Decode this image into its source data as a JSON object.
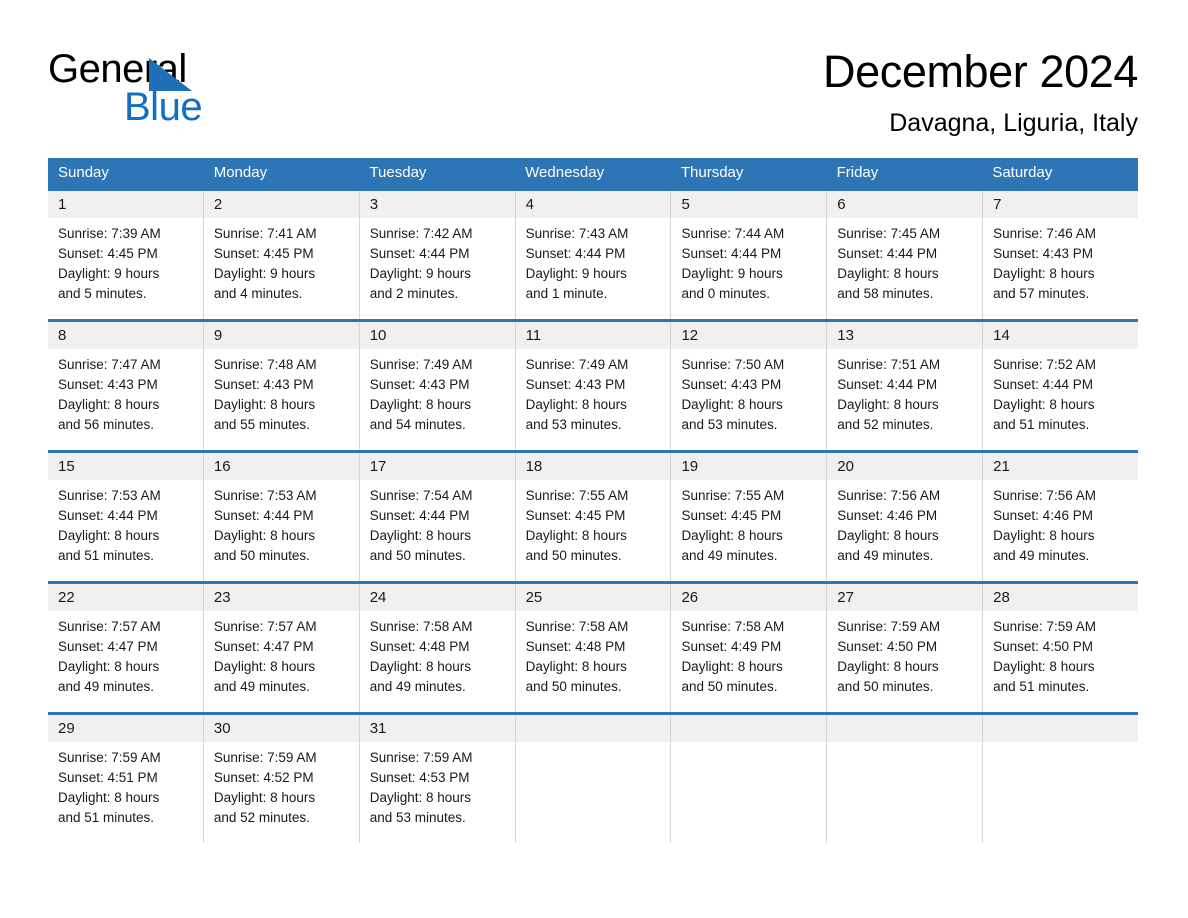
{
  "brand": {
    "name_part1": "General",
    "name_part2": "Blue",
    "triangle_color": "#1e6fb8",
    "blue_color": "#1270c0"
  },
  "header": {
    "month_title": "December 2024",
    "location": "Davagna, Liguria, Italy"
  },
  "theme": {
    "header_blue": "#2e75b6",
    "day_band_gray": "#f0f0f0",
    "divider_gray": "#d5d5d5"
  },
  "weekdays": [
    "Sunday",
    "Monday",
    "Tuesday",
    "Wednesday",
    "Thursday",
    "Friday",
    "Saturday"
  ],
  "weeks": [
    [
      {
        "day": "1",
        "sunrise": "Sunrise: 7:39 AM",
        "sunset": "Sunset: 4:45 PM",
        "daylight_line1": "Daylight: 9 hours",
        "daylight_line2": "and 5 minutes."
      },
      {
        "day": "2",
        "sunrise": "Sunrise: 7:41 AM",
        "sunset": "Sunset: 4:45 PM",
        "daylight_line1": "Daylight: 9 hours",
        "daylight_line2": "and 4 minutes."
      },
      {
        "day": "3",
        "sunrise": "Sunrise: 7:42 AM",
        "sunset": "Sunset: 4:44 PM",
        "daylight_line1": "Daylight: 9 hours",
        "daylight_line2": "and 2 minutes."
      },
      {
        "day": "4",
        "sunrise": "Sunrise: 7:43 AM",
        "sunset": "Sunset: 4:44 PM",
        "daylight_line1": "Daylight: 9 hours",
        "daylight_line2": "and 1 minute."
      },
      {
        "day": "5",
        "sunrise": "Sunrise: 7:44 AM",
        "sunset": "Sunset: 4:44 PM",
        "daylight_line1": "Daylight: 9 hours",
        "daylight_line2": "and 0 minutes."
      },
      {
        "day": "6",
        "sunrise": "Sunrise: 7:45 AM",
        "sunset": "Sunset: 4:44 PM",
        "daylight_line1": "Daylight: 8 hours",
        "daylight_line2": "and 58 minutes."
      },
      {
        "day": "7",
        "sunrise": "Sunrise: 7:46 AM",
        "sunset": "Sunset: 4:43 PM",
        "daylight_line1": "Daylight: 8 hours",
        "daylight_line2": "and 57 minutes."
      }
    ],
    [
      {
        "day": "8",
        "sunrise": "Sunrise: 7:47 AM",
        "sunset": "Sunset: 4:43 PM",
        "daylight_line1": "Daylight: 8 hours",
        "daylight_line2": "and 56 minutes."
      },
      {
        "day": "9",
        "sunrise": "Sunrise: 7:48 AM",
        "sunset": "Sunset: 4:43 PM",
        "daylight_line1": "Daylight: 8 hours",
        "daylight_line2": "and 55 minutes."
      },
      {
        "day": "10",
        "sunrise": "Sunrise: 7:49 AM",
        "sunset": "Sunset: 4:43 PM",
        "daylight_line1": "Daylight: 8 hours",
        "daylight_line2": "and 54 minutes."
      },
      {
        "day": "11",
        "sunrise": "Sunrise: 7:49 AM",
        "sunset": "Sunset: 4:43 PM",
        "daylight_line1": "Daylight: 8 hours",
        "daylight_line2": "and 53 minutes."
      },
      {
        "day": "12",
        "sunrise": "Sunrise: 7:50 AM",
        "sunset": "Sunset: 4:43 PM",
        "daylight_line1": "Daylight: 8 hours",
        "daylight_line2": "and 53 minutes."
      },
      {
        "day": "13",
        "sunrise": "Sunrise: 7:51 AM",
        "sunset": "Sunset: 4:44 PM",
        "daylight_line1": "Daylight: 8 hours",
        "daylight_line2": "and 52 minutes."
      },
      {
        "day": "14",
        "sunrise": "Sunrise: 7:52 AM",
        "sunset": "Sunset: 4:44 PM",
        "daylight_line1": "Daylight: 8 hours",
        "daylight_line2": "and 51 minutes."
      }
    ],
    [
      {
        "day": "15",
        "sunrise": "Sunrise: 7:53 AM",
        "sunset": "Sunset: 4:44 PM",
        "daylight_line1": "Daylight: 8 hours",
        "daylight_line2": "and 51 minutes."
      },
      {
        "day": "16",
        "sunrise": "Sunrise: 7:53 AM",
        "sunset": "Sunset: 4:44 PM",
        "daylight_line1": "Daylight: 8 hours",
        "daylight_line2": "and 50 minutes."
      },
      {
        "day": "17",
        "sunrise": "Sunrise: 7:54 AM",
        "sunset": "Sunset: 4:44 PM",
        "daylight_line1": "Daylight: 8 hours",
        "daylight_line2": "and 50 minutes."
      },
      {
        "day": "18",
        "sunrise": "Sunrise: 7:55 AM",
        "sunset": "Sunset: 4:45 PM",
        "daylight_line1": "Daylight: 8 hours",
        "daylight_line2": "and 50 minutes."
      },
      {
        "day": "19",
        "sunrise": "Sunrise: 7:55 AM",
        "sunset": "Sunset: 4:45 PM",
        "daylight_line1": "Daylight: 8 hours",
        "daylight_line2": "and 49 minutes."
      },
      {
        "day": "20",
        "sunrise": "Sunrise: 7:56 AM",
        "sunset": "Sunset: 4:46 PM",
        "daylight_line1": "Daylight: 8 hours",
        "daylight_line2": "and 49 minutes."
      },
      {
        "day": "21",
        "sunrise": "Sunrise: 7:56 AM",
        "sunset": "Sunset: 4:46 PM",
        "daylight_line1": "Daylight: 8 hours",
        "daylight_line2": "and 49 minutes."
      }
    ],
    [
      {
        "day": "22",
        "sunrise": "Sunrise: 7:57 AM",
        "sunset": "Sunset: 4:47 PM",
        "daylight_line1": "Daylight: 8 hours",
        "daylight_line2": "and 49 minutes."
      },
      {
        "day": "23",
        "sunrise": "Sunrise: 7:57 AM",
        "sunset": "Sunset: 4:47 PM",
        "daylight_line1": "Daylight: 8 hours",
        "daylight_line2": "and 49 minutes."
      },
      {
        "day": "24",
        "sunrise": "Sunrise: 7:58 AM",
        "sunset": "Sunset: 4:48 PM",
        "daylight_line1": "Daylight: 8 hours",
        "daylight_line2": "and 49 minutes."
      },
      {
        "day": "25",
        "sunrise": "Sunrise: 7:58 AM",
        "sunset": "Sunset: 4:48 PM",
        "daylight_line1": "Daylight: 8 hours",
        "daylight_line2": "and 50 minutes."
      },
      {
        "day": "26",
        "sunrise": "Sunrise: 7:58 AM",
        "sunset": "Sunset: 4:49 PM",
        "daylight_line1": "Daylight: 8 hours",
        "daylight_line2": "and 50 minutes."
      },
      {
        "day": "27",
        "sunrise": "Sunrise: 7:59 AM",
        "sunset": "Sunset: 4:50 PM",
        "daylight_line1": "Daylight: 8 hours",
        "daylight_line2": "and 50 minutes."
      },
      {
        "day": "28",
        "sunrise": "Sunrise: 7:59 AM",
        "sunset": "Sunset: 4:50 PM",
        "daylight_line1": "Daylight: 8 hours",
        "daylight_line2": "and 51 minutes."
      }
    ],
    [
      {
        "day": "29",
        "sunrise": "Sunrise: 7:59 AM",
        "sunset": "Sunset: 4:51 PM",
        "daylight_line1": "Daylight: 8 hours",
        "daylight_line2": "and 51 minutes."
      },
      {
        "day": "30",
        "sunrise": "Sunrise: 7:59 AM",
        "sunset": "Sunset: 4:52 PM",
        "daylight_line1": "Daylight: 8 hours",
        "daylight_line2": "and 52 minutes."
      },
      {
        "day": "31",
        "sunrise": "Sunrise: 7:59 AM",
        "sunset": "Sunset: 4:53 PM",
        "daylight_line1": "Daylight: 8 hours",
        "daylight_line2": "and 53 minutes."
      },
      {
        "day": "",
        "sunrise": "",
        "sunset": "",
        "daylight_line1": "",
        "daylight_line2": ""
      },
      {
        "day": "",
        "sunrise": "",
        "sunset": "",
        "daylight_line1": "",
        "daylight_line2": ""
      },
      {
        "day": "",
        "sunrise": "",
        "sunset": "",
        "daylight_line1": "",
        "daylight_line2": ""
      },
      {
        "day": "",
        "sunrise": "",
        "sunset": "",
        "daylight_line1": "",
        "daylight_line2": ""
      }
    ]
  ]
}
